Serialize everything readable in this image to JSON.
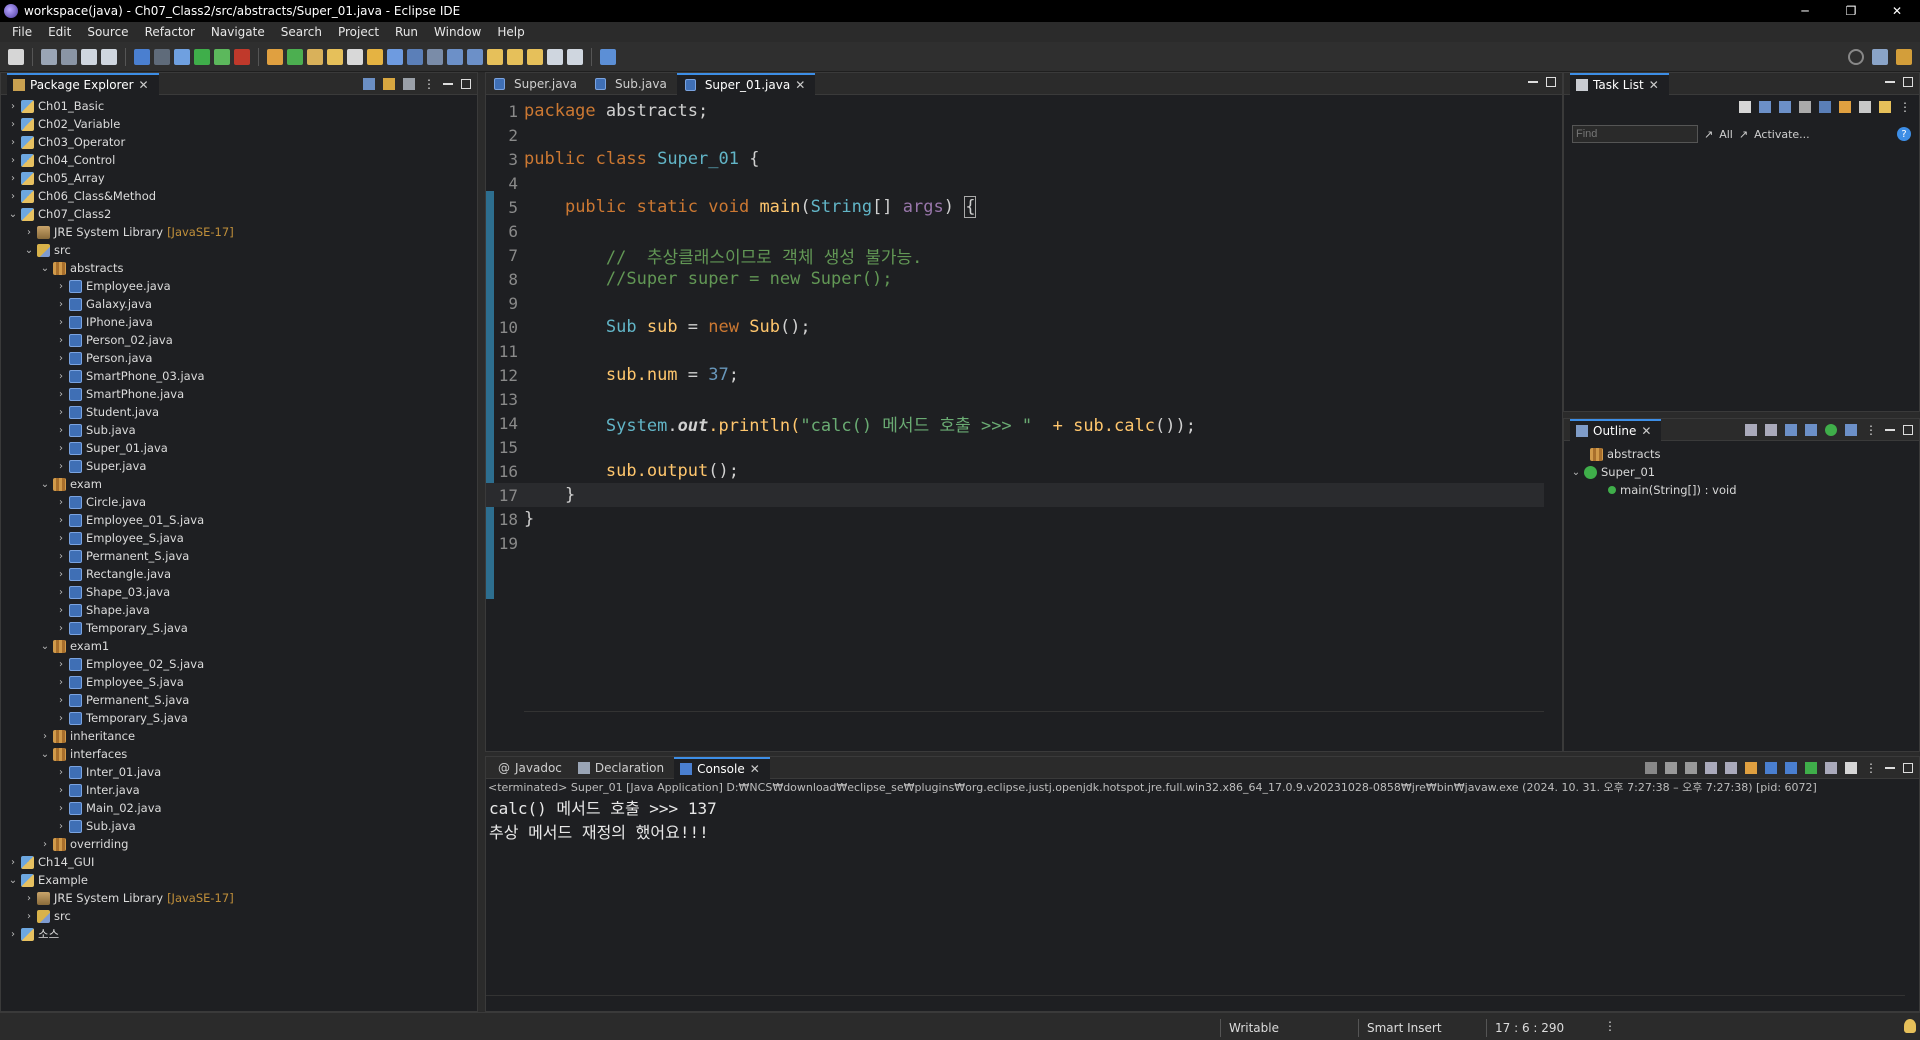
{
  "window": {
    "title": "workspace(java) - Ch07_Class2/src/abstracts/Super_01.java - Eclipse IDE",
    "controls": [
      "─",
      "❐",
      "✕"
    ]
  },
  "menu": [
    "File",
    "Edit",
    "Source",
    "Refactor",
    "Navigate",
    "Search",
    "Project",
    "Run",
    "Window",
    "Help"
  ],
  "package_explorer": {
    "title": "Package Explorer",
    "tree": [
      {
        "label": "Ch01_Basic",
        "type": "proj",
        "twisty": "›"
      },
      {
        "label": "Ch02_Variable",
        "type": "proj",
        "twisty": "›"
      },
      {
        "label": "Ch03_Operator",
        "type": "proj",
        "twisty": "›"
      },
      {
        "label": "Ch04_Control",
        "type": "proj",
        "twisty": "›"
      },
      {
        "label": "Ch05_Array",
        "type": "proj",
        "twisty": "›"
      },
      {
        "label": "Ch06_Class&Method",
        "type": "proj",
        "twisty": "›"
      },
      {
        "label": "Ch07_Class2",
        "type": "proj",
        "twisty": "⌄"
      },
      {
        "label": "JRE System Library",
        "type": "lib",
        "twisty": "›",
        "suffix": "[JavaSE-17]"
      },
      {
        "label": "src",
        "type": "src",
        "twisty": "⌄"
      },
      {
        "label": "abstracts",
        "type": "pkg",
        "twisty": "⌄"
      },
      {
        "label": "Employee.java",
        "type": "java",
        "twisty": "›"
      },
      {
        "label": "Galaxy.java",
        "type": "java",
        "twisty": "›"
      },
      {
        "label": "IPhone.java",
        "type": "java",
        "twisty": "›"
      },
      {
        "label": "Person_02.java",
        "type": "java",
        "twisty": "›"
      },
      {
        "label": "Person.java",
        "type": "java",
        "twisty": "›"
      },
      {
        "label": "SmartPhone_03.java",
        "type": "java",
        "twisty": "›"
      },
      {
        "label": "SmartPhone.java",
        "type": "java",
        "twisty": "›"
      },
      {
        "label": "Student.java",
        "type": "java",
        "twisty": "›"
      },
      {
        "label": "Sub.java",
        "type": "java",
        "twisty": "›"
      },
      {
        "label": "Super_01.java",
        "type": "java",
        "twisty": "›"
      },
      {
        "label": "Super.java",
        "type": "java",
        "twisty": "›"
      },
      {
        "label": "exam",
        "type": "pkg",
        "twisty": "⌄"
      },
      {
        "label": "Circle.java",
        "type": "java",
        "twisty": "›"
      },
      {
        "label": "Employee_01_S.java",
        "type": "java",
        "twisty": "›"
      },
      {
        "label": "Employee_S.java",
        "type": "java",
        "twisty": "›"
      },
      {
        "label": "Permanent_S.java",
        "type": "java",
        "twisty": "›"
      },
      {
        "label": "Rectangle.java",
        "type": "java",
        "twisty": "›"
      },
      {
        "label": "Shape_03.java",
        "type": "java",
        "twisty": "›"
      },
      {
        "label": "Shape.java",
        "type": "java",
        "twisty": "›"
      },
      {
        "label": "Temporary_S.java",
        "type": "java",
        "twisty": "›"
      },
      {
        "label": "exam1",
        "type": "pkg",
        "twisty": "⌄"
      },
      {
        "label": "Employee_02_S.java",
        "type": "java",
        "twisty": "›"
      },
      {
        "label": "Employee_S.java",
        "type": "java",
        "twisty": "›"
      },
      {
        "label": "Permanent_S.java",
        "type": "java",
        "twisty": "›"
      },
      {
        "label": "Temporary_S.java",
        "type": "java",
        "twisty": "›"
      },
      {
        "label": "inheritance",
        "type": "pkg",
        "twisty": "›"
      },
      {
        "label": "interfaces",
        "type": "pkg",
        "twisty": "⌄"
      },
      {
        "label": "Inter_01.java",
        "type": "java",
        "twisty": "›"
      },
      {
        "label": "Inter.java",
        "type": "java",
        "twisty": "›"
      },
      {
        "label": "Main_02.java",
        "type": "java",
        "twisty": "›"
      },
      {
        "label": "Sub.java",
        "type": "java",
        "twisty": "›"
      },
      {
        "label": "overriding",
        "type": "pkg",
        "twisty": "›"
      },
      {
        "label": "Ch14_GUI",
        "type": "proj",
        "twisty": "›"
      },
      {
        "label": "Example",
        "type": "proj",
        "twisty": "⌄"
      },
      {
        "label": "JRE System Library",
        "type": "lib",
        "twisty": "›",
        "suffix": "[JavaSE-17]"
      },
      {
        "label": "src",
        "type": "src",
        "twisty": "›"
      },
      {
        "label": "소스",
        "type": "proj",
        "twisty": "›"
      }
    ]
  },
  "editor": {
    "tabs": [
      {
        "label": "Super.java",
        "active": false
      },
      {
        "label": "Sub.java",
        "active": false
      },
      {
        "label": "Super_01.java",
        "active": true
      }
    ],
    "line_numbers": [
      "1",
      "2",
      "3",
      "4",
      "5",
      "6",
      "7",
      "8",
      "9",
      "10",
      "11",
      "12",
      "13",
      "14",
      "15",
      "16",
      "17",
      "18",
      "19"
    ],
    "code": {
      "l1_kw": "package",
      "l1_rest": " abstracts;",
      "l3_kw1": "public",
      "l3_kw2": " class ",
      "l3_name": "Super_01",
      "l3_rest": " {",
      "l5_indent": "    ",
      "l5_kw": "public static void",
      "l5_sp": " ",
      "l5_meth": "main",
      "l5_p1": "(",
      "l5_type": "String",
      "l5_p2": "[] ",
      "l5_arg": "args",
      "l5_p3": ") ",
      "l5_brace": "{",
      "l7": "        //  추상클래스이므로 객체 생성 불가능.",
      "l8": "        //Super super = new Super();",
      "l10_i": "        ",
      "l10_t": "Sub",
      "l10_v": " sub ",
      "l10_e": "= ",
      "l10_new": "new",
      "l10_ctor": " Sub",
      "l10_end": "();",
      "l12_a": "        sub.",
      "l12_f": "num",
      "l12_b": " = ",
      "l12_n": "37",
      "l12_c": ";",
      "l14_i": "        ",
      "l14_sys": "System",
      "l14_dot": ".",
      "l14_out": "out",
      "l14_pr": ".println(",
      "l14_str": "\"calc() 메서드 호출 >>> \"",
      "l14_plus": "  + sub.",
      "l14_calc": "calc",
      "l14_end": "());",
      "l16_a": "        sub.",
      "l16_m": "output",
      "l16_b": "();",
      "l17": "    }",
      "l18": "}"
    }
  },
  "task_list": {
    "title": "Task List",
    "find_placeholder": "Find",
    "all_label": "All",
    "activate_label": "Activate..."
  },
  "outline": {
    "title": "Outline",
    "items": [
      "abstracts",
      "Super_01",
      "main(String[]) : void"
    ]
  },
  "bottom_tabs": [
    {
      "label": "Javadoc",
      "active": false
    },
    {
      "label": "Declaration",
      "active": false
    },
    {
      "label": "Console",
      "active": true
    }
  ],
  "console": {
    "terminated": "<terminated> Super_01 [Java Application] D:₩NCS₩download₩eclipse_se₩plugins₩org.eclipse.justj.openjdk.hotspot.jre.full.win32.x86_64_17.0.9.v20231028-0858₩jre₩bin₩javaw.exe  (2024. 10. 31. 오후 7:27:38 – 오후 7:27:38) [pid: 6072]",
    "lines": [
      "calc() 메서드 호출 >>> 137",
      "추상 메서드 재정의 했어요!!!"
    ]
  },
  "status": {
    "writable": "Writable",
    "insert_mode": "Smart Insert",
    "position": "17 : 6 : 290"
  },
  "colors": {
    "accent": "#3d8ee6",
    "keyword": "#cc7832",
    "comment": "#629755",
    "string": "#6aab73"
  }
}
